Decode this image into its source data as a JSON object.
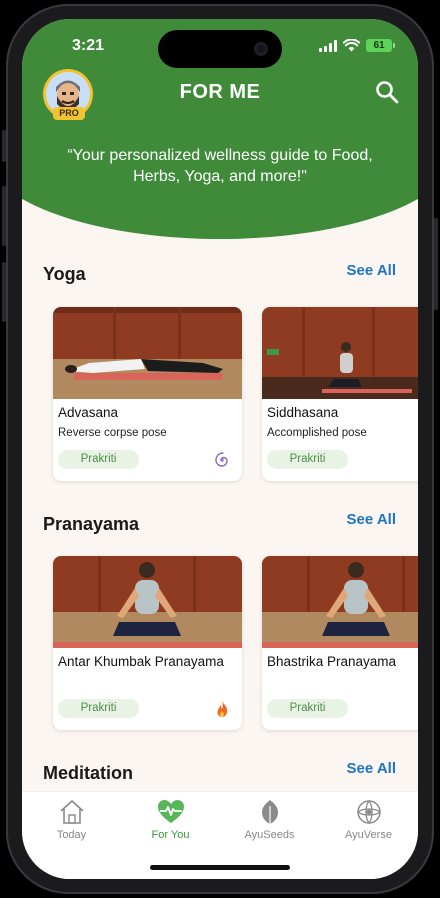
{
  "status_bar": {
    "time": "3:21",
    "battery": "61"
  },
  "header": {
    "title": "FOR ME",
    "pro_badge": "PRO",
    "tagline": "“Your personalized wellness guide to Food, Herbs, Yoga, and more!\""
  },
  "sections": [
    {
      "title": "Yoga",
      "see_all": "See All",
      "cards": [
        {
          "name": "Advasana",
          "subtitle": "Reverse corpse pose",
          "chip": "Prakriti",
          "flag_icon": "spiral-icon"
        },
        {
          "name": "Siddhasana",
          "subtitle": "Accomplished pose",
          "chip": "Prakriti"
        }
      ]
    },
    {
      "title": "Pranayama",
      "see_all": "See All",
      "cards": [
        {
          "name": "Antar Khumbak Pranayama",
          "chip": "Prakriti",
          "flag_icon": "fire-icon"
        },
        {
          "name": "Bhastrika Pranayama",
          "chip": "Prakriti"
        }
      ]
    },
    {
      "title": "Meditation",
      "see_all": "See All"
    }
  ],
  "bottom_nav": [
    {
      "label": "Today",
      "icon": "house-icon",
      "active": false
    },
    {
      "label": "For You",
      "icon": "heart-pulse-icon",
      "active": true
    },
    {
      "label": "AyuSeeds",
      "icon": "leaf-icon",
      "active": false
    },
    {
      "label": "AyuVerse",
      "icon": "mandala-icon",
      "active": false
    }
  ],
  "colors": {
    "header_green": "#3f8b3a",
    "link_blue": "#1f74c7",
    "chip_bg": "#e8f3e6",
    "chip_text": "#4e8c47",
    "nav_active": "#3a9a3a",
    "pro_gold": "#f2c230"
  }
}
